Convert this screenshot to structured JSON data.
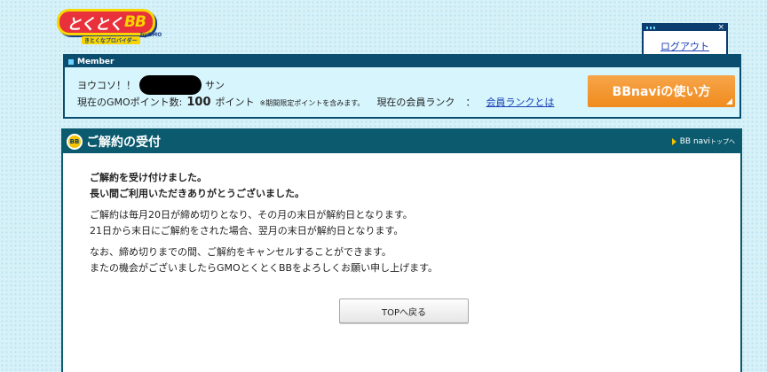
{
  "logo": {
    "main": "とくとく",
    "bb": "BB",
    "sub": "きとくなプロバイダー",
    "gmo": "byGMO"
  },
  "logout": {
    "label": "ログアウト",
    "close": "×"
  },
  "member": {
    "heading": "Member",
    "greeting": "ヨウコソ！！",
    "suffix": "サン",
    "points_label": "現在のGMOポイント数:",
    "points_value": "100",
    "points_unit": "ポイント",
    "points_note": "※期間限定ポイントを含みます。",
    "rank_label": "現在の会員ランク",
    "rank_sep": "：",
    "rank_link": "会員ランクとは"
  },
  "bbnavi_button": "BBnaviの使い方",
  "panel": {
    "icon": "BB",
    "title": "ご解約の受付",
    "toplink_main": "BB navi",
    "toplink_small": "トップへ",
    "messages": {
      "line1": "ご解約を受け付けました。",
      "line2": "長い間ご利用いただきありがとうございました。",
      "line3": "ご解約は毎月20日が締め切りとなり、その月の末日が解約日となります。",
      "line4": "21日から末日にご解約をされた場合、翌月の末日が解約日となります。",
      "line5": "なお、締め切りまでの間、ご解約をキャンセルすることができます。",
      "line6": "またの機会がございましたらGMOとくとくBBをよろしくお願い申し上げます。"
    },
    "top_button": "TOPへ戻る"
  }
}
